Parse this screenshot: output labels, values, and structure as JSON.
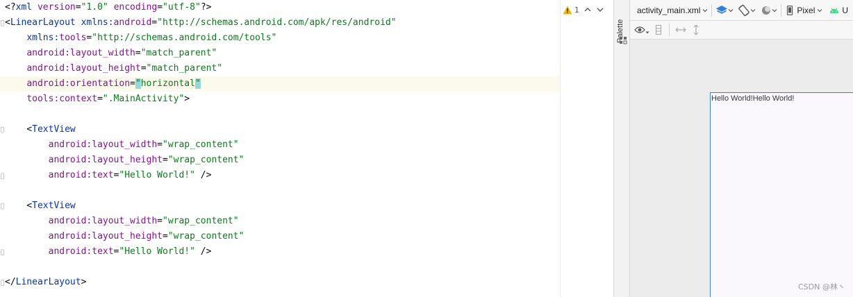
{
  "editor": {
    "current_line": 6,
    "lines": [
      {
        "tokens": [
          {
            "t": "pun",
            "v": "<?"
          },
          {
            "t": "tag",
            "v": "xml "
          },
          {
            "t": "attr",
            "v": "version"
          },
          {
            "t": "pun",
            "v": "="
          },
          {
            "t": "val",
            "v": "\"1.0\" "
          },
          {
            "t": "attr",
            "v": "encoding"
          },
          {
            "t": "pun",
            "v": "="
          },
          {
            "t": "val",
            "v": "\"utf-8\""
          },
          {
            "t": "pun",
            "v": "?>"
          }
        ]
      },
      {
        "fold": "start",
        "tokens": [
          {
            "t": "pun",
            "v": "<"
          },
          {
            "t": "tag",
            "v": "LinearLayout "
          },
          {
            "t": "ns",
            "v": "xmlns:"
          },
          {
            "t": "attr",
            "v": "android"
          },
          {
            "t": "pun",
            "v": "="
          },
          {
            "t": "val",
            "v": "\"http://schemas.android.com/apk/res/android\""
          }
        ]
      },
      {
        "tokens": [
          {
            "t": "pun",
            "v": "    "
          },
          {
            "t": "ns",
            "v": "xmlns:"
          },
          {
            "t": "attr",
            "v": "tools"
          },
          {
            "t": "pun",
            "v": "="
          },
          {
            "t": "val",
            "v": "\"http://schemas.android.com/tools\""
          }
        ]
      },
      {
        "tokens": [
          {
            "t": "pun",
            "v": "    "
          },
          {
            "t": "attr",
            "v": "android:layout_width"
          },
          {
            "t": "pun",
            "v": "="
          },
          {
            "t": "val",
            "v": "\"match_parent\""
          }
        ]
      },
      {
        "tokens": [
          {
            "t": "pun",
            "v": "    "
          },
          {
            "t": "attr",
            "v": "android:layout_height"
          },
          {
            "t": "pun",
            "v": "="
          },
          {
            "t": "val",
            "v": "\"match_parent\""
          }
        ]
      },
      {
        "tokens": [
          {
            "t": "pun",
            "v": "    "
          },
          {
            "t": "attr",
            "v": "android:orientation"
          },
          {
            "t": "pun",
            "v": "="
          },
          {
            "t": "valhl",
            "v": "\""
          },
          {
            "t": "val",
            "v": "horizontal"
          },
          {
            "t": "valhl",
            "v": "\""
          }
        ]
      },
      {
        "tokens": [
          {
            "t": "pun",
            "v": "    "
          },
          {
            "t": "attr",
            "v": "tools:context"
          },
          {
            "t": "pun",
            "v": "="
          },
          {
            "t": "val",
            "v": "\".MainActivity\""
          },
          {
            "t": "pun",
            "v": ">"
          }
        ]
      },
      {
        "tokens": []
      },
      {
        "fold": "start",
        "tokens": [
          {
            "t": "pun",
            "v": "    <"
          },
          {
            "t": "tag",
            "v": "TextView"
          }
        ]
      },
      {
        "tokens": [
          {
            "t": "pun",
            "v": "        "
          },
          {
            "t": "attr",
            "v": "android:layout_width"
          },
          {
            "t": "pun",
            "v": "="
          },
          {
            "t": "val",
            "v": "\"wrap_content\""
          }
        ]
      },
      {
        "tokens": [
          {
            "t": "pun",
            "v": "        "
          },
          {
            "t": "attr",
            "v": "android:layout_height"
          },
          {
            "t": "pun",
            "v": "="
          },
          {
            "t": "val",
            "v": "\"wrap_content\""
          }
        ]
      },
      {
        "fold": "end",
        "tokens": [
          {
            "t": "pun",
            "v": "        "
          },
          {
            "t": "attr",
            "v": "android:text"
          },
          {
            "t": "pun",
            "v": "="
          },
          {
            "t": "val",
            "v": "\"Hello World!\""
          },
          {
            "t": "pun",
            "v": " />"
          }
        ]
      },
      {
        "tokens": []
      },
      {
        "fold": "start",
        "tokens": [
          {
            "t": "pun",
            "v": "    <"
          },
          {
            "t": "tag",
            "v": "TextView"
          }
        ]
      },
      {
        "tokens": [
          {
            "t": "pun",
            "v": "        "
          },
          {
            "t": "attr",
            "v": "android:layout_width"
          },
          {
            "t": "pun",
            "v": "="
          },
          {
            "t": "val",
            "v": "\"wrap_content\""
          }
        ]
      },
      {
        "tokens": [
          {
            "t": "pun",
            "v": "        "
          },
          {
            "t": "attr",
            "v": "android:layout_height"
          },
          {
            "t": "pun",
            "v": "="
          },
          {
            "t": "val",
            "v": "\"wrap_content\""
          }
        ]
      },
      {
        "fold": "end",
        "tokens": [
          {
            "t": "pun",
            "v": "        "
          },
          {
            "t": "attr",
            "v": "android:text"
          },
          {
            "t": "pun",
            "v": "="
          },
          {
            "t": "val",
            "v": "\"Hello World!\""
          },
          {
            "t": "pun",
            "v": " />"
          }
        ]
      },
      {
        "tokens": []
      },
      {
        "fold": "end",
        "tokens": [
          {
            "t": "pun",
            "v": "</"
          },
          {
            "t": "tag",
            "v": "LinearLayout"
          },
          {
            "t": "pun",
            "v": ">"
          }
        ]
      }
    ]
  },
  "inspection": {
    "warning_count": "1",
    "icon": "warning-icon"
  },
  "palette": {
    "label": "Palette"
  },
  "toolbar": {
    "file_name": "activity_main.xml",
    "device": "Pixel",
    "api_label": "U"
  },
  "preview": {
    "text_views": [
      "Hello World!",
      "Hello World!"
    ]
  },
  "watermark": "CSDN @林丶",
  "colors": {
    "tag": "#0033b3",
    "attribute": "#871094",
    "value": "#067d17",
    "match_highlight": "#93d9d9",
    "device_border": "#3b7ad9",
    "android_green": "#3ddc84",
    "layers_blue": "#2f7ed8"
  }
}
